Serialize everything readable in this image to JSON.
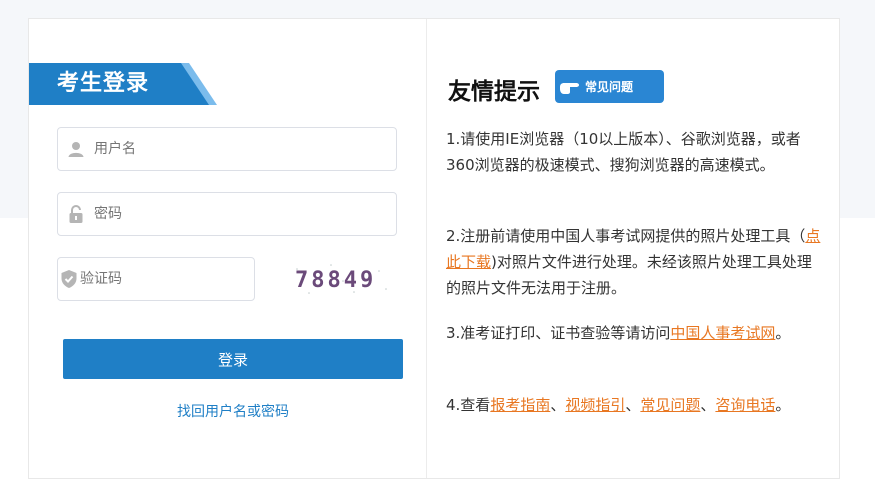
{
  "login": {
    "title": "考生登录",
    "username_placeholder": "用户名",
    "password_placeholder": "密码",
    "captcha_placeholder": "验证码",
    "captcha_text": "78849",
    "submit_label": "登录",
    "recover_label": "找回用户名或密码"
  },
  "tips": {
    "title": "友情提示",
    "faq_badge": "常见问题",
    "tip1": "1.请使用IE浏览器（10以上版本）、谷歌浏览器，或者360浏览器的极速模式、搜狗浏览器的高速模式。",
    "tip2_prefix": "2.注册前请使用中国人事考试网提供的照片处理工具（",
    "tip2_link": "点此下载",
    "tip2_suffix": ")对照片文件进行处理。未经该照片处理工具处理的照片文件无法用于注册。",
    "tip3_prefix": "3.准考证打印、证书查验等请访问",
    "tip3_link": "中国人事考试网",
    "tip3_suffix": "。",
    "tip4_prefix": "4.查看",
    "tip4_link1": "报考指南",
    "tip4_sep1": "、",
    "tip4_link2": "视频指引",
    "tip4_sep2": "、",
    "tip4_link3": "常见问题",
    "tip4_sep3": "、",
    "tip4_link4": "咨询电话",
    "tip4_suffix": "。"
  },
  "colors": {
    "primary": "#1f7fc6",
    "link_orange": "#e87722",
    "ribbon": "#1f7fc6"
  }
}
